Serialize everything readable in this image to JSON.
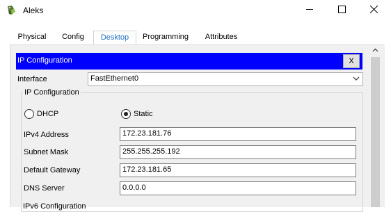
{
  "window": {
    "title": "Aleks",
    "icons": {
      "app": "printer-icon",
      "minimize": "minimize-icon",
      "maximize": "maximize-icon",
      "close": "close-icon"
    }
  },
  "tabs": [
    {
      "label": "Physical",
      "active": false
    },
    {
      "label": "Config",
      "active": false
    },
    {
      "label": "Desktop",
      "active": true
    },
    {
      "label": "Programming",
      "active": false
    },
    {
      "label": "Attributes",
      "active": false
    }
  ],
  "ip_config": {
    "header_title": "IP Configuration",
    "close_label": "X",
    "interface_label": "Interface",
    "interface_value": "FastEthernet0",
    "group_title": "IP Configuration",
    "dhcp_label": "DHCP",
    "static_label": "Static",
    "mode": "Static",
    "fields": [
      {
        "label": "IPv4 Address",
        "value": "172.23.181.76"
      },
      {
        "label": "Subnet Mask",
        "value": "255.255.255.192"
      },
      {
        "label": "Default Gateway",
        "value": "172.23.181.65"
      },
      {
        "label": "DNS Server",
        "value": "0.0.0.0"
      }
    ],
    "next_group_title": "IPv6 Configuration"
  },
  "colors": {
    "header_bg": "#0000ff",
    "active_tab": "#1f6fc5",
    "tab_underline": "#2a8fd6"
  }
}
